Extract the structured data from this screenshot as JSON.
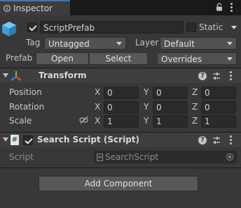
{
  "window": {
    "tab_label": "Inspector",
    "lock_icon": "lock-icon",
    "menu_icon": "kebab-menu-icon"
  },
  "header": {
    "object_name": "ScriptPrefab",
    "active": true,
    "static_label": "Static",
    "static_checked": false,
    "tag_label": "Tag",
    "tag_value": "Untagged",
    "layer_label": "Layer",
    "layer_value": "Default",
    "prefab_label": "Prefab",
    "open_button": "Open",
    "select_button": "Select",
    "overrides_value": "Overrides"
  },
  "transform": {
    "title": "Transform",
    "rows": [
      {
        "label": "Position",
        "x": "0",
        "y": "0",
        "z": "0"
      },
      {
        "label": "Rotation",
        "x": "0",
        "y": "0",
        "z": "0"
      },
      {
        "label": "Scale",
        "x": "1",
        "y": "1",
        "z": "1"
      }
    ],
    "axis_x": "X",
    "axis_y": "Y",
    "axis_z": "Z"
  },
  "search_script": {
    "title": "Search Script (Script)",
    "enabled": true,
    "script_label": "Script",
    "script_value": "SearchScript"
  },
  "footer": {
    "add_component": "Add Component"
  },
  "colors": {
    "accent": "#3a79bb",
    "background": "#383838",
    "field": "#2a2a2a"
  }
}
